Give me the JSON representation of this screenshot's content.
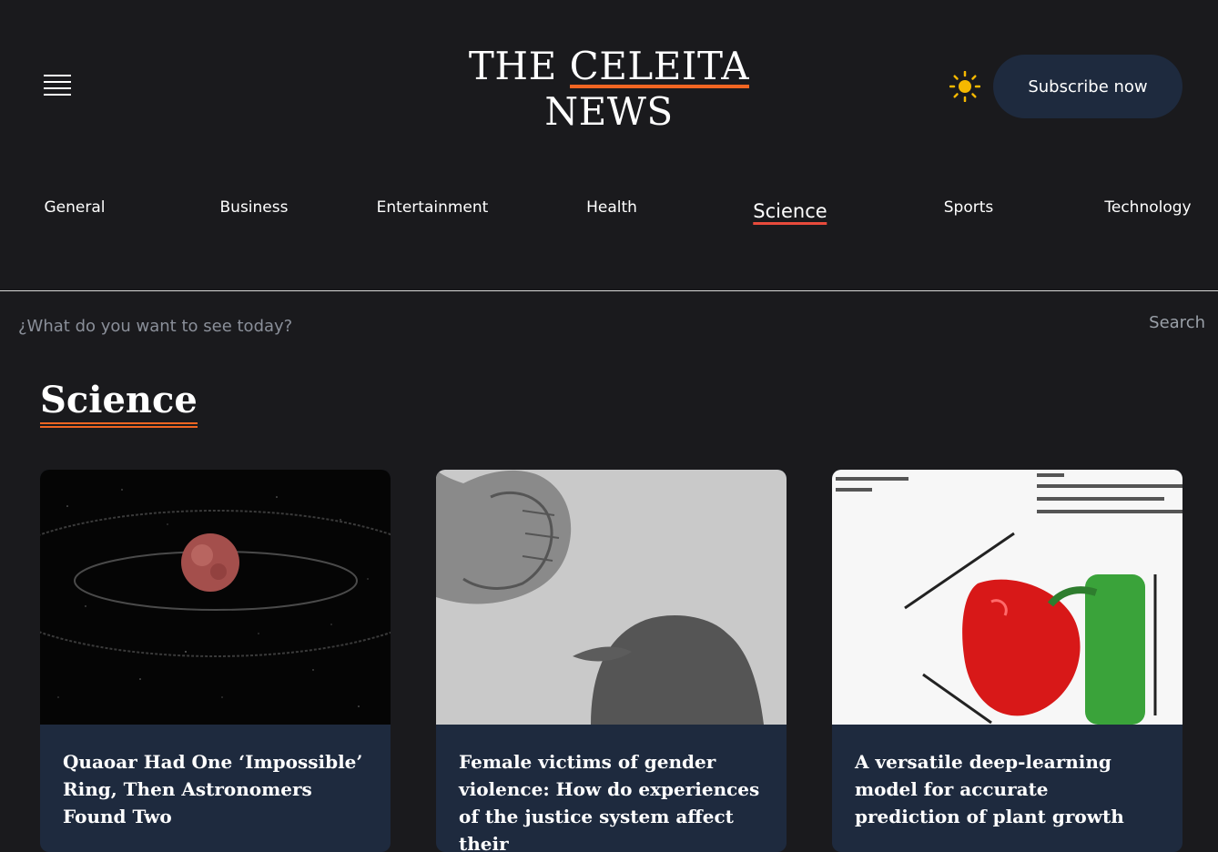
{
  "header": {
    "logo_line1_prefix": "THE ",
    "logo_line1_brand": "CELEITA",
    "logo_line2": "NEWS",
    "subscribe_label": "Subscribe now",
    "theme_icon": "sun-icon",
    "menu_icon": "hamburger-menu-icon"
  },
  "nav": {
    "items": [
      {
        "label": "General"
      },
      {
        "label": "Business"
      },
      {
        "label": "Entertainment"
      },
      {
        "label": "Health"
      },
      {
        "label": "Science",
        "active": true
      },
      {
        "label": "Sports"
      },
      {
        "label": "Technology"
      }
    ]
  },
  "search": {
    "placeholder": "¿What do you want to see today?",
    "button_label": "Search"
  },
  "section": {
    "title": "Science"
  },
  "cards": [
    {
      "title": "Quaoar Had One ‘Impossible’ Ring, Then Astronomers Found Two",
      "image": "planet-with-rings"
    },
    {
      "title": "Female victims of gender violence: How do experiences of the justice system affect their",
      "image": "fist-over-silhouette"
    },
    {
      "title": "A versatile deep-learning model for accurate prediction of plant growth",
      "image": "plant-growth-diagram"
    }
  ],
  "colors": {
    "background": "#1a1a1d",
    "accent": "#f16522",
    "active_underline": "#e84b3c",
    "card_bg": "#1e2a3e",
    "sun": "#f5b800"
  }
}
